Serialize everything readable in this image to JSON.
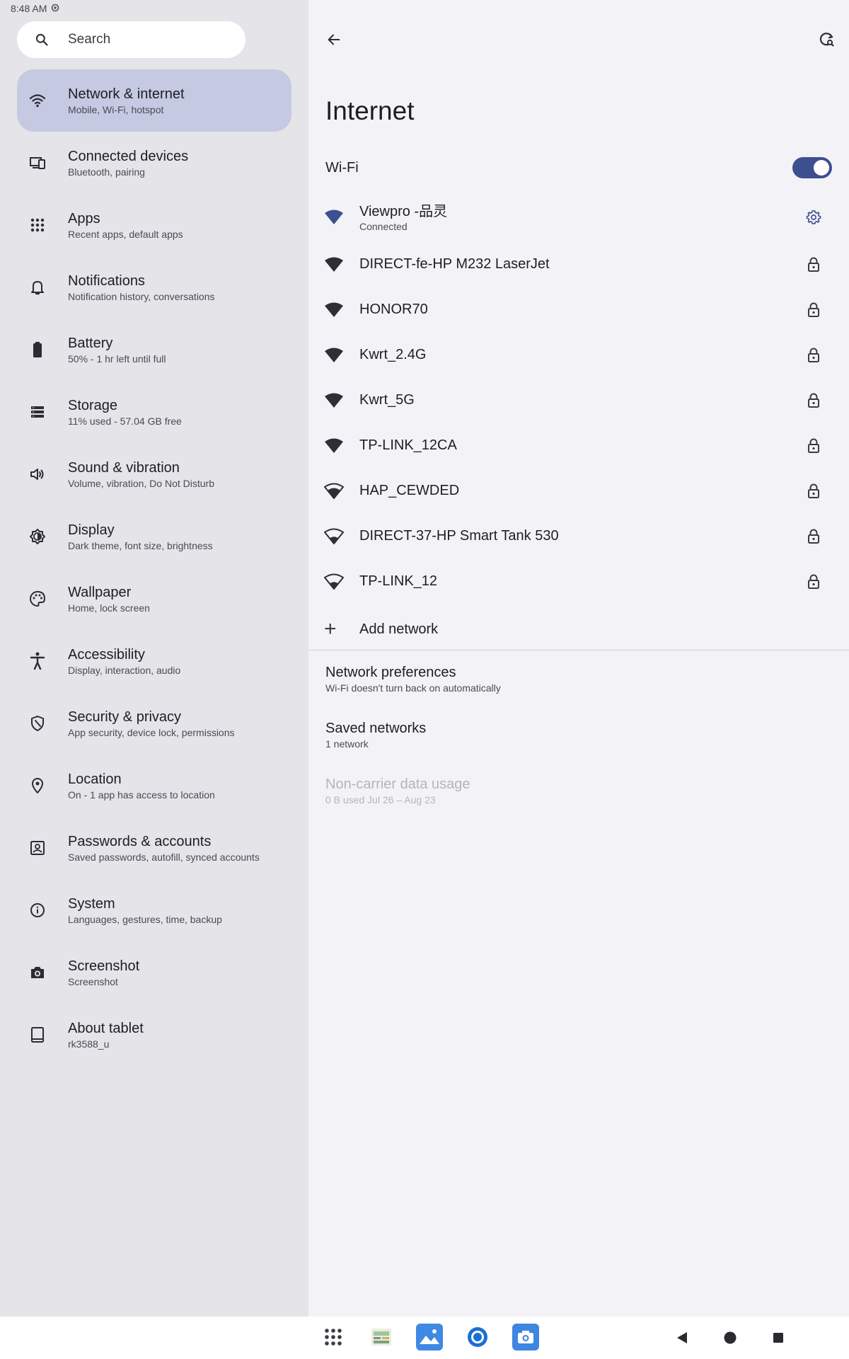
{
  "status_bar": {
    "time": "8:48 AM"
  },
  "sidebar": {
    "search_placeholder": "Search",
    "items": [
      {
        "title": "Network & internet",
        "subtitle": "Mobile, Wi-Fi, hotspot",
        "icon": "wifi-icon",
        "active": true
      },
      {
        "title": "Connected devices",
        "subtitle": "Bluetooth, pairing",
        "icon": "devices-icon"
      },
      {
        "title": "Apps",
        "subtitle": "Recent apps, default apps",
        "icon": "apps-grid-icon"
      },
      {
        "title": "Notifications",
        "subtitle": "Notification history, conversations",
        "icon": "bell-icon"
      },
      {
        "title": "Battery",
        "subtitle": "50% - 1 hr left until full",
        "icon": "battery-icon"
      },
      {
        "title": "Storage",
        "subtitle": "11% used - 57.04 GB free",
        "icon": "storage-icon"
      },
      {
        "title": "Sound & vibration",
        "subtitle": "Volume, vibration, Do Not Disturb",
        "icon": "speaker-icon"
      },
      {
        "title": "Display",
        "subtitle": "Dark theme, font size, brightness",
        "icon": "brightness-icon"
      },
      {
        "title": "Wallpaper",
        "subtitle": "Home, lock screen",
        "icon": "palette-icon"
      },
      {
        "title": "Accessibility",
        "subtitle": "Display, interaction, audio",
        "icon": "accessibility-icon"
      },
      {
        "title": "Security & privacy",
        "subtitle": "App security, device lock, permissions",
        "icon": "shield-icon"
      },
      {
        "title": "Location",
        "subtitle": "On - 1 app has access to location",
        "icon": "location-pin-icon"
      },
      {
        "title": "Passwords & accounts",
        "subtitle": "Saved passwords, autofill, synced accounts",
        "icon": "account-box-icon"
      },
      {
        "title": "System",
        "subtitle": "Languages, gestures, time, backup",
        "icon": "info-icon"
      },
      {
        "title": "Screenshot",
        "subtitle": "Screenshot",
        "icon": "camera-icon"
      },
      {
        "title": "About tablet",
        "subtitle": "rk3588_u",
        "icon": "tablet-icon"
      }
    ]
  },
  "main": {
    "title": "Internet",
    "wifi_label": "Wi-Fi",
    "wifi_enabled": true,
    "networks": [
      {
        "name": "Viewpro -品灵",
        "status": "Connected",
        "signal": 4,
        "trailing": "gear-icon",
        "connected": true
      },
      {
        "name": "DIRECT-fe-HP M232 LaserJet",
        "signal": 4,
        "trailing": "lock-icon"
      },
      {
        "name": "HONOR70",
        "signal": 4,
        "trailing": "lock-icon"
      },
      {
        "name": "Kwrt_2.4G",
        "signal": 4,
        "trailing": "lock-icon"
      },
      {
        "name": "Kwrt_5G",
        "signal": 4,
        "trailing": "lock-icon"
      },
      {
        "name": "TP-LINK_12CA",
        "signal": 4,
        "trailing": "lock-icon"
      },
      {
        "name": "HAP_CEWDED",
        "signal": 3,
        "trailing": "lock-icon"
      },
      {
        "name": "DIRECT-37-HP Smart Tank 530",
        "signal": 2,
        "trailing": "lock-icon"
      },
      {
        "name": "TP-LINK_12",
        "signal": 2,
        "trailing": "lock-icon"
      }
    ],
    "add_network": "Add network",
    "preferences": [
      {
        "title": "Network preferences",
        "subtitle": "Wi-Fi doesn't turn back on automatically",
        "disabled": false
      },
      {
        "title": "Saved networks",
        "subtitle": "1 network",
        "disabled": false
      },
      {
        "title": "Non-carrier data usage",
        "subtitle": "0 B used Jul 26 – Aug 23",
        "disabled": true
      }
    ]
  },
  "colors": {
    "accent": "#3e4f8f",
    "active_nav": "#c5cae2",
    "sidebar_bg": "#e4e4e9",
    "main_bg": "#f3f3f7"
  }
}
